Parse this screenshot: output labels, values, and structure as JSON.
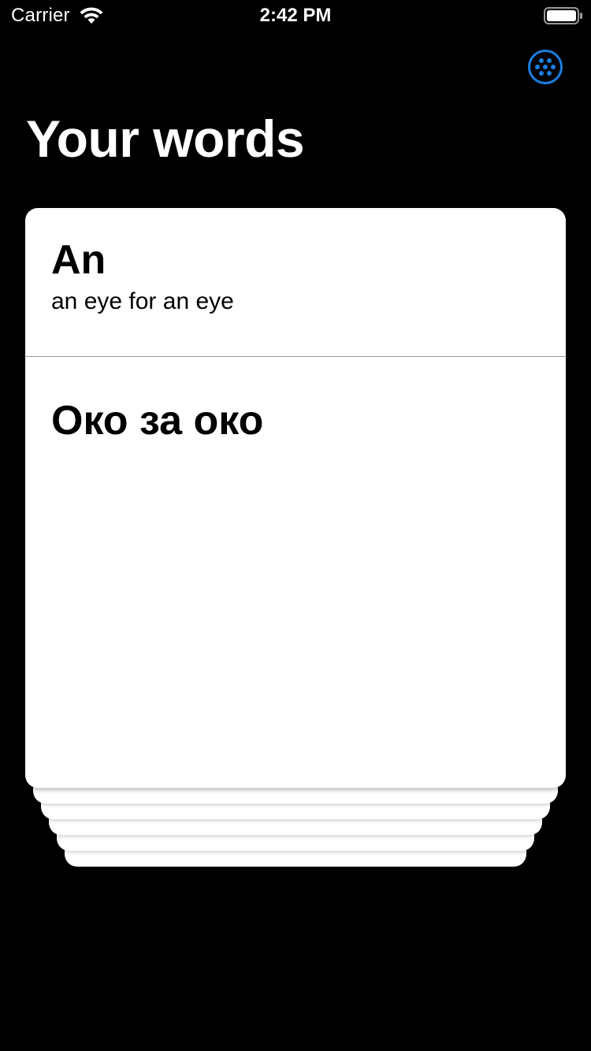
{
  "status_bar": {
    "carrier": "Carrier",
    "time": "2:42 PM",
    "wifi_icon": "wifi-icon",
    "battery_icon": "battery-icon"
  },
  "header": {
    "action_icon": "dots-grid-circle-icon",
    "accent_color": "#1a7fe0",
    "title": "Your words"
  },
  "card": {
    "word": "An",
    "example": "an eye for an eye",
    "translation": "Око за око"
  },
  "stack": {
    "card_count": 5
  },
  "colors": {
    "background": "#000000",
    "card": "#ffffff",
    "text_primary": "#000000",
    "title_text": "#ffffff"
  }
}
